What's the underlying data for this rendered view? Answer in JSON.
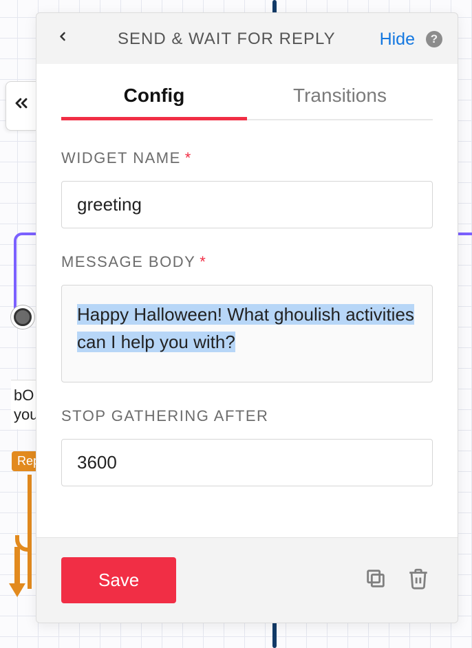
{
  "header": {
    "title": "SEND & WAIT FOR REPLY",
    "hide_label": "Hide"
  },
  "tabs": {
    "config": "Config",
    "transitions": "Transitions"
  },
  "form": {
    "widget_name": {
      "label": "WIDGET NAME",
      "value": "greeting"
    },
    "message_body": {
      "label": "MESSAGE BODY",
      "value": "Happy Halloween! What ghoulish activities can I help you with?"
    },
    "stop_after": {
      "label": "STOP GATHERING AFTER",
      "value": "3600"
    }
  },
  "footer": {
    "save_label": "Save"
  },
  "background": {
    "snippet_line1": "bO",
    "snippet_line2": "you",
    "orange_tag": "Rep"
  },
  "colors": {
    "accent_red": "#f12e45",
    "link_blue": "#1478e0",
    "purple": "#7b61ff",
    "orange": "#e28a1e"
  }
}
